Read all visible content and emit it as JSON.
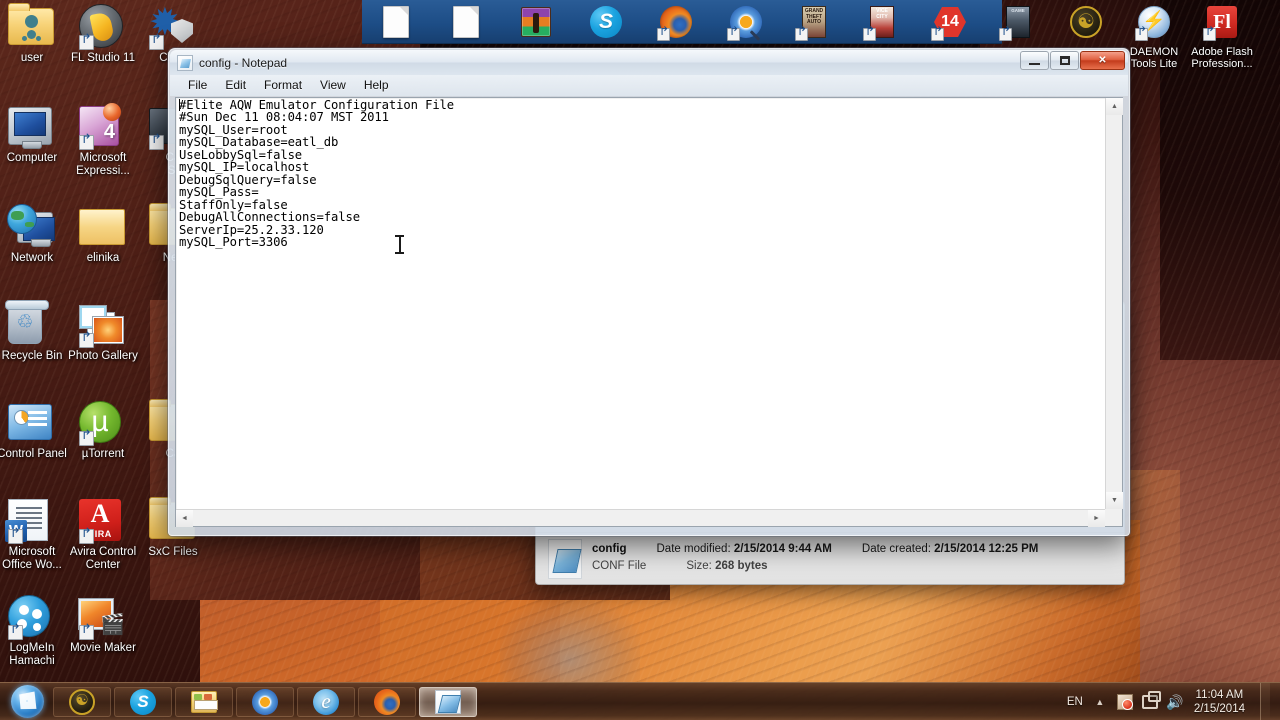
{
  "desktop": {
    "wallpaper_name": "antelope-canyon-wallpaper",
    "colors": {
      "canyon_dark": "#3a150f",
      "canyon_mid": "#8a4a3a",
      "canyon_bright": "#d66f2b",
      "taskbar": "#301a10",
      "dock_blue": "#1d4d86",
      "accent_close": "#c33c1c"
    },
    "icons": [
      {
        "label": "user",
        "icon": "user-folder-icon",
        "shortcut": false
      },
      {
        "label": "FL Studio 11",
        "icon": "fl-studio-icon",
        "shortcut": true
      },
      {
        "label": "Chea",
        "icon": "cheat-engine-icon",
        "shortcut": true
      },
      {
        "label": "Computer",
        "icon": "computer-icon",
        "shortcut": false
      },
      {
        "label": "Microsoft Expressi...",
        "icon": "ms-expression-icon",
        "shortcut": true
      },
      {
        "label": "Ca\nSt",
        "icon": "dark-app-icon",
        "shortcut": true
      },
      {
        "label": "Network",
        "icon": "network-icon",
        "shortcut": false
      },
      {
        "label": "elinika",
        "icon": "folder-icon",
        "shortcut": false
      },
      {
        "label": "Nec",
        "icon": "folder-icon",
        "shortcut": false
      },
      {
        "label": "Recycle Bin",
        "icon": "recycle-bin-icon",
        "shortcut": false
      },
      {
        "label": "Photo Gallery",
        "icon": "photo-gallery-icon",
        "shortcut": true
      },
      {
        "label": "Control Panel",
        "icon": "control-panel-icon",
        "shortcut": false
      },
      {
        "label": "µTorrent",
        "icon": "utorrent-icon",
        "shortcut": true
      },
      {
        "label": "Ca",
        "icon": "folder-icon",
        "shortcut": false
      },
      {
        "label": "Microsoft Office Wo...",
        "icon": "ms-word-icon",
        "shortcut": true
      },
      {
        "label": "Avira Control Center",
        "icon": "avira-icon",
        "shortcut": true
      },
      {
        "label": "SxC Files",
        "icon": "folder-icon",
        "shortcut": false
      },
      {
        "label": "LogMeIn Hamachi",
        "icon": "hamachi-icon",
        "shortcut": true
      },
      {
        "label": "Movie Maker",
        "icon": "movie-maker-icon",
        "shortcut": true
      }
    ]
  },
  "top_dock": {
    "items": [
      {
        "label": "",
        "icon": "blank-document-icon",
        "shortcut": false
      },
      {
        "label": "",
        "icon": "blank-document-icon",
        "shortcut": false
      },
      {
        "label": "",
        "icon": "winrar-icon",
        "shortcut": false
      },
      {
        "label": "",
        "icon": "skype-icon",
        "shortcut": false
      },
      {
        "label": "",
        "icon": "firefox-icon",
        "shortcut": true
      },
      {
        "label": "",
        "icon": "sun-gear-icon",
        "shortcut": true
      },
      {
        "label": "",
        "icon": "gta-san-andreas-icon",
        "shortcut": true
      },
      {
        "label": "",
        "icon": "gta-vice-city-icon",
        "shortcut": true
      },
      {
        "label": "",
        "icon": "nero-14-icon",
        "shortcut": true
      },
      {
        "label": "",
        "icon": "dark-game-icon",
        "shortcut": true
      },
      {
        "label": "",
        "icon": "dragon-emblem-icon",
        "shortcut": false
      },
      {
        "label": "DAEMON Tools Lite",
        "icon": "daemon-tools-icon",
        "shortcut": true
      },
      {
        "label": "Adobe Flash Profession...",
        "icon": "adobe-flash-icon",
        "shortcut": true
      }
    ]
  },
  "notepad": {
    "title": "config - Notepad",
    "icon": "notepad-icon",
    "menus": [
      "File",
      "Edit",
      "Format",
      "View",
      "Help"
    ],
    "window_buttons": {
      "minimize": "minimize-button",
      "maximize": "maximize-button",
      "close": "✕"
    },
    "content": "#Elite AQW Emulator Configuration File\n#Sun Dec 11 08:04:07 MST 2011\nmySQL_User=root\nmySQL_Database=eatl_db\nUseLobbySql=false\nmySQL_IP=localhost\nDebugSqlQuery=false\nmySQL_Pass=\nStaffOnly=false\nDebugAllConnections=false\nServerIp=25.2.33.120\nmySQL_Port=3306",
    "scroll": {
      "up_arrow": "▲",
      "down_arrow": "▼",
      "left_arrow": "◄",
      "right_arrow": "►"
    }
  },
  "explorer": {
    "details": {
      "file_name": "config",
      "file_type": "CONF File",
      "size_label": "Size:",
      "size_value": "268 bytes",
      "date_modified_label": "Date modified:",
      "date_modified_value": "2/15/2014 9:44 AM",
      "date_created_label": "Date created:",
      "date_created_value": "2/15/2014 12:25 PM"
    }
  },
  "taskbar": {
    "start_button": "start-orb",
    "buttons": [
      {
        "icon": "dragon-emblem-icon",
        "active": false
      },
      {
        "icon": "skype-icon",
        "active": false
      },
      {
        "icon": "file-explorer-icon",
        "active": false
      },
      {
        "icon": "sun-gear-icon",
        "active": false
      },
      {
        "icon": "internet-explorer-icon",
        "active": false
      },
      {
        "icon": "firefox-icon",
        "active": false
      },
      {
        "icon": "notepad-icon",
        "active": true
      }
    ],
    "tray": {
      "language": "EN",
      "show_hidden": "▲",
      "action_center": "action-center-icon",
      "network": "network-icon",
      "volume": "🔊",
      "time": "11:04 AM",
      "date": "2/15/2014"
    }
  }
}
